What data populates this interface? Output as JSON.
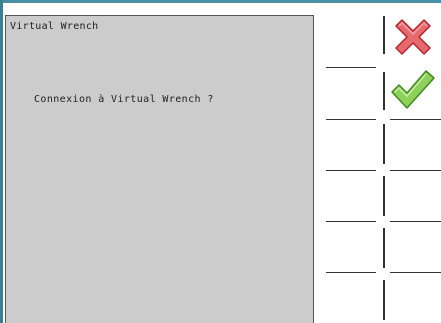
{
  "dialog": {
    "title": "Virtual Wrench",
    "message": "Connexion à Virtual Wrench ?"
  },
  "softkeys": [
    {
      "name": "cancel",
      "icon": "close-icon",
      "color": "#e0484c"
    },
    {
      "name": "confirm",
      "icon": "check-icon",
      "color": "#6fbf3a"
    },
    {
      "name": "empty-3"
    },
    {
      "name": "empty-4"
    },
    {
      "name": "empty-5"
    },
    {
      "name": "empty-6"
    }
  ]
}
